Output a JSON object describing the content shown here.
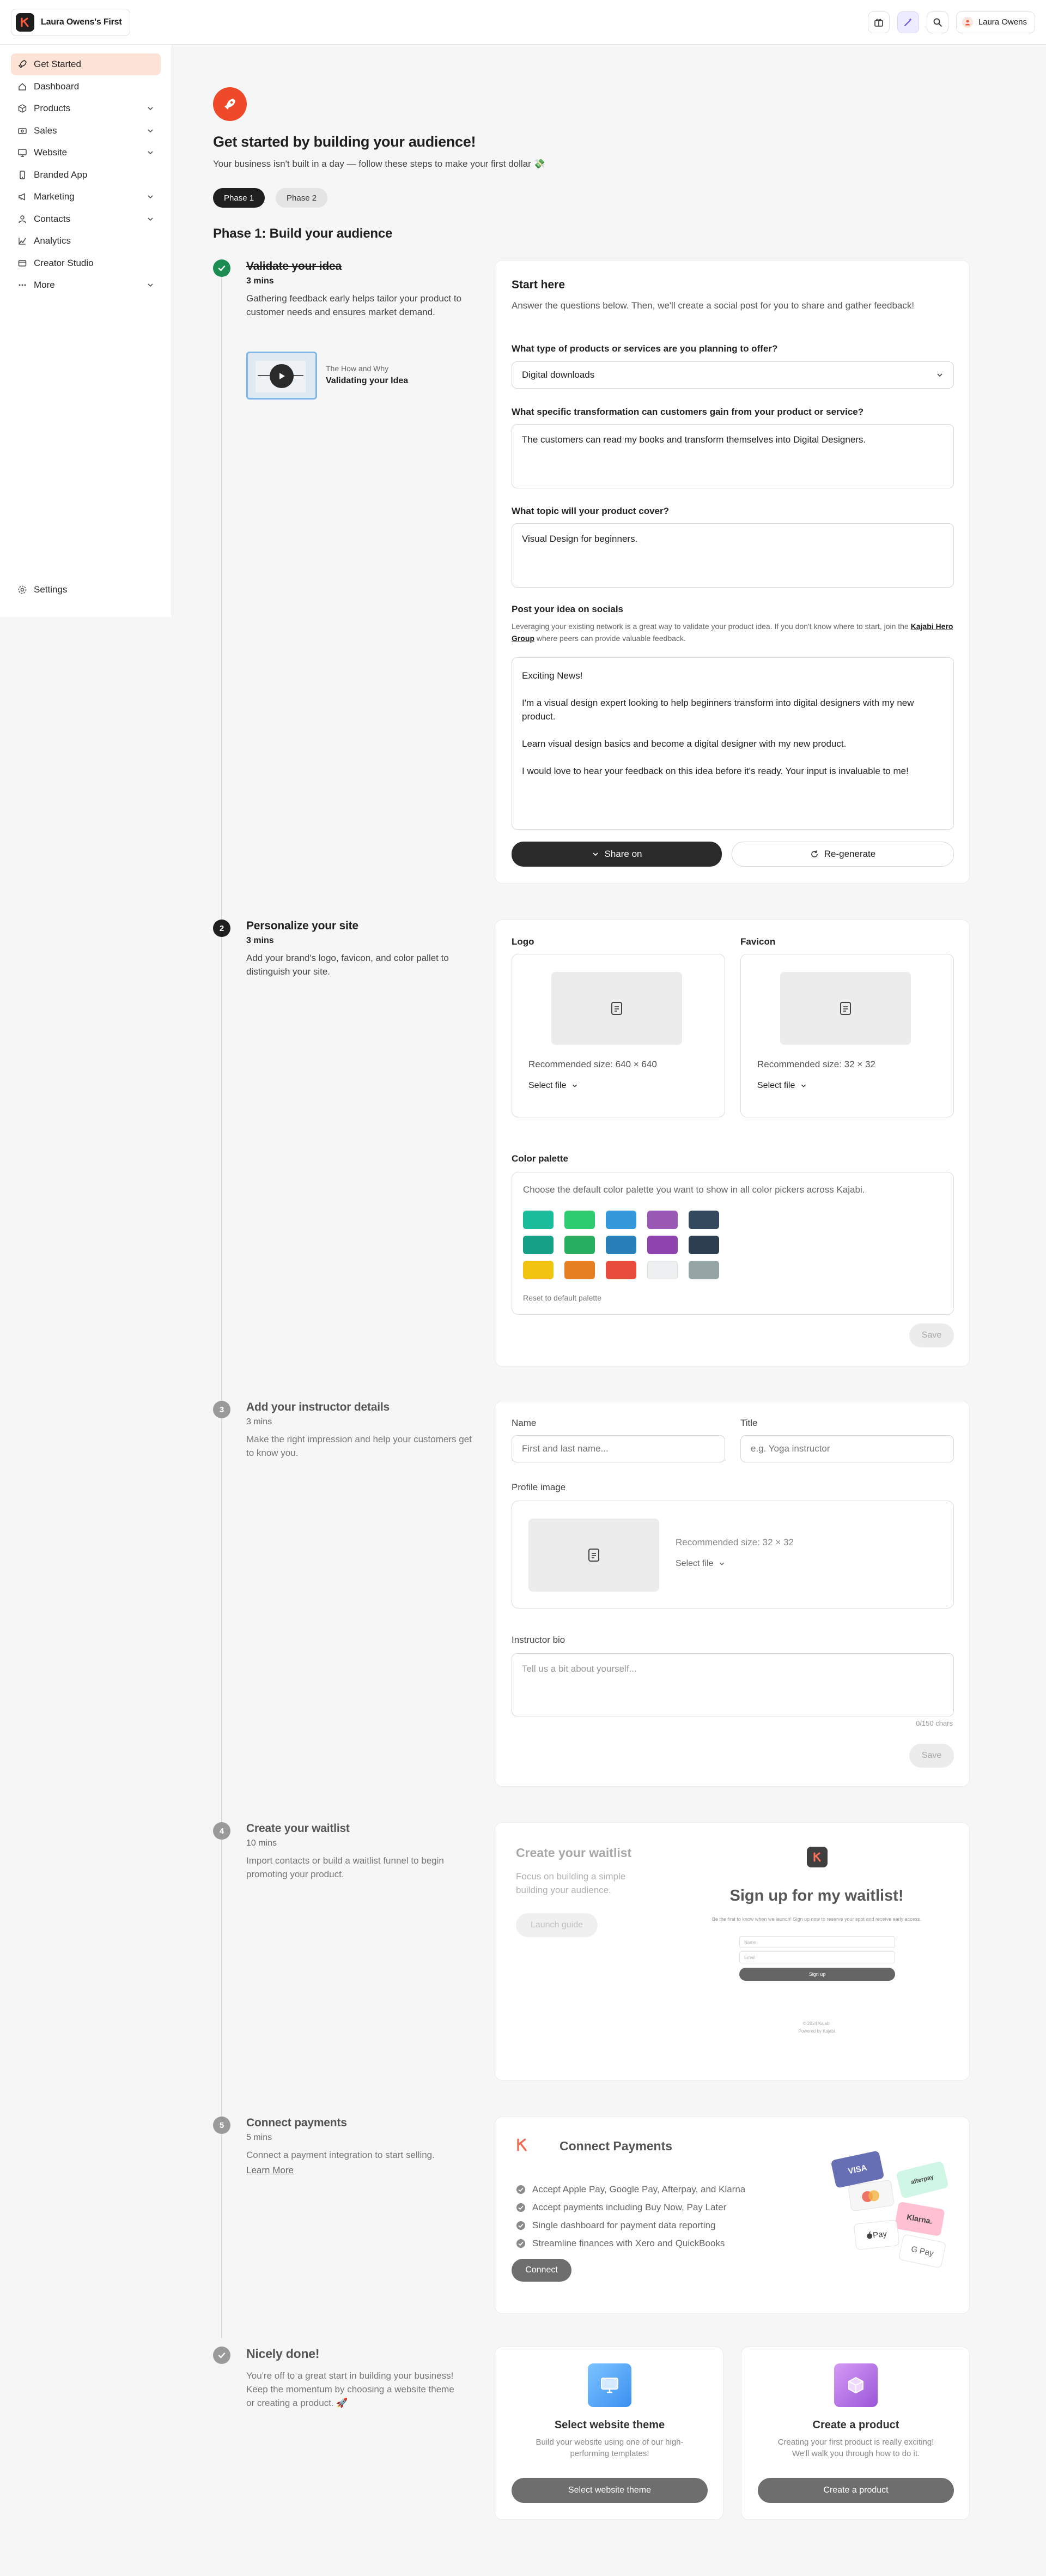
{
  "topbar": {
    "brand_name": "Laura Owens's First",
    "user_name": "Laura Owens"
  },
  "sidebar": {
    "items": [
      {
        "label": "Get Started",
        "icon": "rocket-icon",
        "active": true,
        "expandable": false
      },
      {
        "label": "Dashboard",
        "icon": "home-icon",
        "active": false,
        "expandable": false
      },
      {
        "label": "Products",
        "icon": "box-icon",
        "active": false,
        "expandable": true
      },
      {
        "label": "Sales",
        "icon": "cash-icon",
        "active": false,
        "expandable": true
      },
      {
        "label": "Website",
        "icon": "monitor-icon",
        "active": false,
        "expandable": true
      },
      {
        "label": "Branded App",
        "icon": "phone-icon",
        "active": false,
        "expandable": false
      },
      {
        "label": "Marketing",
        "icon": "megaphone-icon",
        "active": false,
        "expandable": true
      },
      {
        "label": "Contacts",
        "icon": "people-icon",
        "active": false,
        "expandable": true
      },
      {
        "label": "Analytics",
        "icon": "chart-icon",
        "active": false,
        "expandable": false
      },
      {
        "label": "Creator Studio",
        "icon": "studio-icon",
        "active": false,
        "expandable": false
      },
      {
        "label": "More",
        "icon": "dots-icon",
        "active": false,
        "expandable": true
      }
    ],
    "settings_label": "Settings"
  },
  "hero": {
    "title": "Get started by building your audience!",
    "subtitle": "Your business isn't built in a day — follow these steps to make your first dollar 💸"
  },
  "phase_tabs": [
    "Phase 1",
    "Phase 2"
  ],
  "phase_title": "Phase 1: Build your audience",
  "step1": {
    "title": "Validate your idea",
    "mins": "3 mins",
    "desc": "Gathering feedback early helps tailor your product to customer needs and ensures market demand.",
    "video_kicker": "The How and Why",
    "video_title": "Validating your Idea",
    "card": {
      "heading": "Start here",
      "intro": "Answer the questions below. Then, we'll create a social post for you to share and gather feedback!",
      "q1_label": "What type of products or services are you planning to offer?",
      "q1_value": "Digital downloads",
      "q2_label": "What specific transformation can customers gain from your product or service?",
      "q2_value": "The customers can read my books and transform themselves into Digital Designers.",
      "q3_label": "What topic will your product cover?",
      "q3_value": "Visual Design for beginners.",
      "post_label": "Post your idea on socials",
      "post_help_1": "Leveraging your existing network is a great way to validate your product idea. If you don't know where to start, join the",
      "post_help_link": "Kajabi Hero Group",
      "post_help_2": "where peers can provide valuable feedback.",
      "post_p1": "Exciting News!",
      "post_p2": "I'm a visual design expert looking to help beginners transform into digital designers with my new product.",
      "post_p3": "Learn visual design basics and become a digital designer with my new product.",
      "post_p4": "I would love to hear your feedback on this idea before it's ready. Your input is invaluable to me!",
      "share_label": "Share on",
      "regen_label": "Re-generate"
    }
  },
  "step2": {
    "number": "2",
    "title": "Personalize your site",
    "mins": "3 mins",
    "desc": "Add your brand's logo, favicon, and color pallet to distinguish your site.",
    "logo_label": "Logo",
    "logo_rec": "Recommended size: 640 × 640",
    "favicon_label": "Favicon",
    "favicon_rec": "Recommended size: 32 × 32",
    "select_file": "Select file",
    "palette_label": "Color palette",
    "palette_desc": "Choose the default color palette you want to show in all color pickers across Kajabi.",
    "palette_colors": [
      "#1abc9c",
      "#2ecc71",
      "#3498db",
      "#9b59b6",
      "#34495e",
      "#16a085",
      "#27ae60",
      "#2980b9",
      "#8e44ad",
      "#2c3e50",
      "#f1c40f",
      "#e67e22",
      "#e74c3c",
      "#ecf0f1",
      "#95a5a6"
    ],
    "reset_label": "Reset to default palette",
    "save_label": "Save"
  },
  "step3": {
    "number": "3",
    "title": "Add your instructor details",
    "mins": "3 mins",
    "desc": "Make the right impression and help your customers get to know you.",
    "name_label": "Name",
    "name_placeholder": "First and last name...",
    "title_label": "Title",
    "title_placeholder": "e.g. Yoga instructor",
    "profile_label": "Profile image",
    "profile_rec": "Recommended size: 32 × 32",
    "select_file": "Select file",
    "bio_label": "Instructor bio",
    "bio_placeholder": "Tell us a bit about yourself...",
    "char_count": "0/150 chars",
    "save_label": "Save"
  },
  "step4": {
    "number": "4",
    "title": "Create your waitlist",
    "mins": "10 mins",
    "desc": "Import contacts or build a waitlist funnel to begin promoting your product.",
    "card_title": "Create your waitlist",
    "card_desc": "Focus on building a simple building your audience.",
    "launch_label": "Launch guide",
    "preview_title": "Sign up for my waitlist!",
    "preview_sub": "Be the first to know when we launch! Sign up now to reserve your spot and receive early access.",
    "preview_name": "Name",
    "preview_email": "Email",
    "preview_btn": "Sign up",
    "preview_footer_1": "© 2024 Kajabi",
    "preview_footer_2": "Powered by Kajabi"
  },
  "step5": {
    "number": "5",
    "title": "Connect payments",
    "mins": "5 mins",
    "desc": "Connect a payment integration to start selling.",
    "learn_more": "Learn More",
    "card_title": "Connect Payments",
    "bullets": [
      "Accept Apple Pay, Google Pay, Afterpay, and Klarna",
      "Accept payments including Buy Now, Pay Later",
      "Single dashboard for payment data reporting",
      "Streamline finances with Xero and QuickBooks"
    ],
    "connect_label": "Connect",
    "pay_cards": [
      "VISA",
      "afterpay",
      "Klarna.",
      "Pay",
      "G Pay"
    ]
  },
  "final": {
    "title": "Nicely done!",
    "desc": "You're off to a great start in building your business! Keep the momentum by choosing a website theme or creating a product. 🚀",
    "theme_title": "Select website theme",
    "theme_desc": "Build your website using one of our high-performing templates!",
    "theme_btn": "Select website theme",
    "product_title": "Create a product",
    "product_desc": "Creating your first product is really exciting! We'll walk you through how to do it.",
    "product_btn": "Create a product"
  }
}
